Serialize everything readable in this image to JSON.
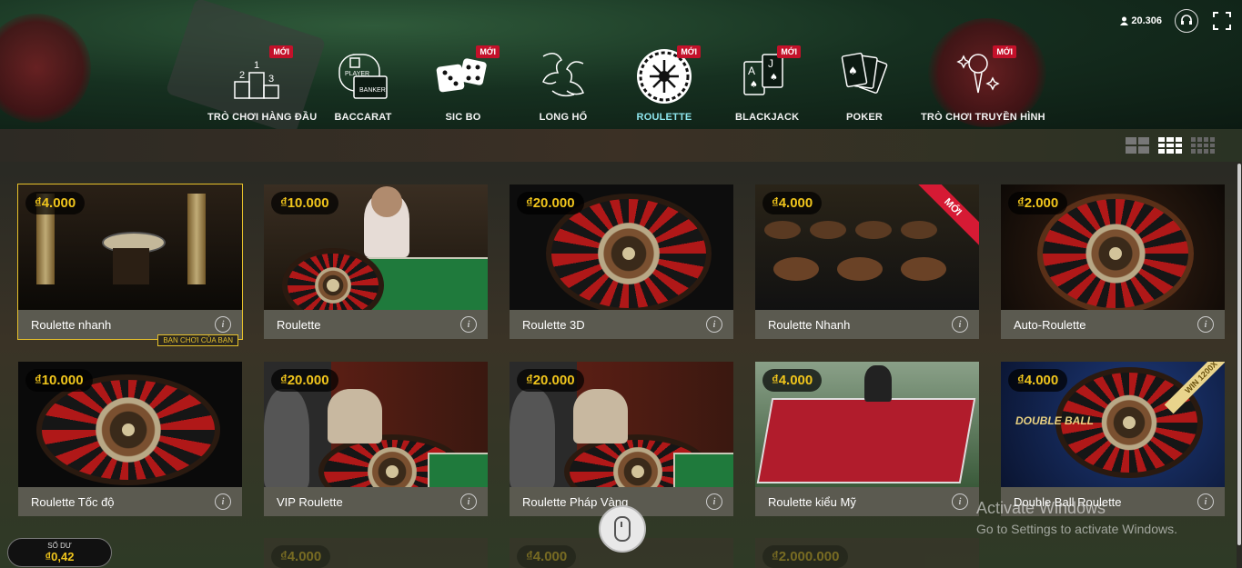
{
  "header": {
    "online_count": "20.306",
    "icons": [
      "user-icon",
      "support-icon",
      "fullscreen-icon"
    ]
  },
  "nav": {
    "new_label": "MỚI",
    "items": [
      {
        "label": "TRÒ CHƠI HÀNG ĐẦU",
        "icon": "podium-icon",
        "is_new": true
      },
      {
        "label": "BACCARAT",
        "icon": "baccarat-icon",
        "is_new": false,
        "icon_text_1": "PLAYER",
        "icon_text_2": "BANKER"
      },
      {
        "label": "SIC BO",
        "icon": "dice-icon",
        "is_new": true
      },
      {
        "label": "LONG HỔ",
        "icon": "dragon-tiger-icon",
        "is_new": false
      },
      {
        "label": "ROULETTE",
        "icon": "roulette-icon",
        "is_new": true,
        "active": true
      },
      {
        "label": "BLACKJACK",
        "icon": "blackjack-cards-icon",
        "is_new": true
      },
      {
        "label": "POKER",
        "icon": "poker-cards-icon",
        "is_new": false
      },
      {
        "label": "TRÒ CHƠI TRUYỀN HÌNH",
        "icon": "microphone-icon",
        "is_new": true
      }
    ]
  },
  "games": [
    {
      "name": "Roulette nhanh",
      "price": "₫4.000",
      "badge": "BẠN CHƠI CỦA BẠN"
    },
    {
      "name": "Roulette",
      "price": "₫10.000"
    },
    {
      "name": "Roulette 3D",
      "price": "₫20.000"
    },
    {
      "name": "Roulette Nhanh",
      "price": "₫4.000",
      "ribbon": "MỚI"
    },
    {
      "name": "Auto-Roulette",
      "price": "₫2.000"
    },
    {
      "name": "Roulette Tốc độ",
      "price": "₫10.000"
    },
    {
      "name": "VIP Roulette",
      "price": "₫20.000"
    },
    {
      "name": "Roulette Pháp Vàng",
      "price": "₫20.000"
    },
    {
      "name": "Roulette kiểu Mỹ",
      "price": "₫4.000"
    },
    {
      "name": "Double Ball Roulette",
      "price": "₫4.000",
      "ribbon": "WIN 1200X",
      "logo": "DOUBLE BALL"
    }
  ],
  "partial_row": [
    "₫4.000",
    "₫4.000",
    "₫2.000.000"
  ],
  "balance": {
    "label": "SỐ DƯ",
    "value": "₫0,42"
  },
  "watermark": {
    "line1": "Activate Windows",
    "line2": "Go to Settings to activate Windows."
  },
  "colors": {
    "accent": "#f0c51c",
    "active_nav": "#8ee6ee",
    "new_badge": "#c4112a"
  }
}
